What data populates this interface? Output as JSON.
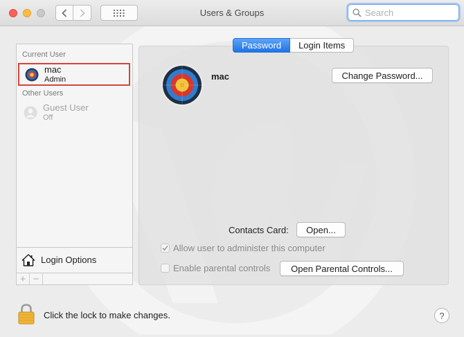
{
  "window": {
    "title": "Users & Groups"
  },
  "search": {
    "placeholder": "Search",
    "value": ""
  },
  "sidebar": {
    "current_user_label": "Current User",
    "other_users_label": "Other Users",
    "current_user": {
      "name": "mac",
      "role": "Admin"
    },
    "other_users": [
      {
        "name": "Guest User",
        "role": "Off"
      }
    ],
    "login_options_label": "Login Options",
    "add_symbol": "+",
    "remove_symbol": "−"
  },
  "tabs": [
    {
      "label": "Password",
      "active": true
    },
    {
      "label": "Login Items",
      "active": false
    }
  ],
  "main": {
    "username": "mac",
    "change_password_label": "Change Password...",
    "contacts_card_label": "Contacts Card:",
    "open_label": "Open...",
    "allow_admin": {
      "label": "Allow user to administer this computer",
      "checked": true
    },
    "parental_controls": {
      "label": "Enable parental controls",
      "checked": false
    },
    "open_parental_label": "Open Parental Controls..."
  },
  "footer": {
    "lock_text": "Click the lock to make changes.",
    "help_symbol": "?"
  },
  "colors": {
    "accent": "#1f73e6",
    "selection_outline": "#d4453a",
    "lock": "#f0b536"
  }
}
